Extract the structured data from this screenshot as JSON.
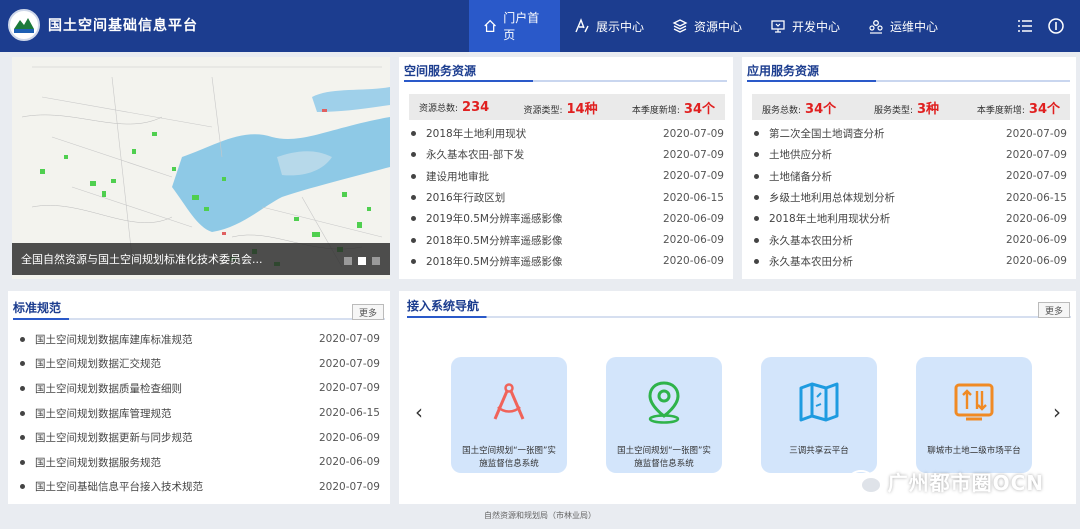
{
  "header": {
    "title": "国土空间基础信息平台",
    "nav": [
      {
        "label": "门户首页",
        "icon": "home-icon",
        "active": true
      },
      {
        "label": "展示中心",
        "icon": "display-icon",
        "active": false
      },
      {
        "label": "资源中心",
        "icon": "layers-icon",
        "active": false
      },
      {
        "label": "开发中心",
        "icon": "monitor-icon",
        "active": false
      },
      {
        "label": "运维中心",
        "icon": "users-icon",
        "active": false
      }
    ]
  },
  "slider": {
    "caption": "全国自然资源与国土空间规划标准化技术委员会...",
    "active_dot": 2
  },
  "spatial": {
    "title": "空间服务资源",
    "stats": [
      {
        "label": "资源总数:",
        "value": "234"
      },
      {
        "label": "资源类型:",
        "value": "14种"
      },
      {
        "label": "本季度新增:",
        "value": "34个"
      }
    ],
    "items": [
      {
        "title": "2018年土地利用现状",
        "date": "2020-07-09"
      },
      {
        "title": "永久基本农田-部下发",
        "date": "2020-07-09"
      },
      {
        "title": "建设用地审批",
        "date": "2020-07-09"
      },
      {
        "title": "2016年行政区划",
        "date": "2020-06-15"
      },
      {
        "title": "2019年0.5M分辨率遥感影像",
        "date": "2020-06-09"
      },
      {
        "title": "2018年0.5M分辨率遥感影像",
        "date": "2020-06-09"
      },
      {
        "title": "2018年0.5M分辨率遥感影像",
        "date": "2020-06-09"
      }
    ]
  },
  "app": {
    "title": "应用服务资源",
    "stats": [
      {
        "label": "服务总数:",
        "value": "34个"
      },
      {
        "label": "服务类型:",
        "value": "3种"
      },
      {
        "label": "本季度新增:",
        "value": "34个"
      }
    ],
    "items": [
      {
        "title": "第二次全国土地调查分析",
        "date": "2020-07-09"
      },
      {
        "title": "土地供应分析",
        "date": "2020-07-09"
      },
      {
        "title": "土地储备分析",
        "date": "2020-07-09"
      },
      {
        "title": "乡级土地利用总体规划分析",
        "date": "2020-06-15"
      },
      {
        "title": "2018年土地利用现状分析",
        "date": "2020-06-09"
      },
      {
        "title": "永久基本农田分析",
        "date": "2020-06-09"
      },
      {
        "title": "永久基本农田分析",
        "date": "2020-06-09"
      }
    ]
  },
  "standards": {
    "title": "标准规范",
    "more": "更多",
    "items": [
      {
        "title": "国土空间规划数据库建库标准规范",
        "date": "2020-07-09"
      },
      {
        "title": "国土空间规划数据汇交规范",
        "date": "2020-07-09"
      },
      {
        "title": "国土空间规划数据质量检查细则",
        "date": "2020-07-09"
      },
      {
        "title": "国土空间规划数据库管理规范",
        "date": "2020-06-15"
      },
      {
        "title": "国土空间规划数据更新与同步规范",
        "date": "2020-06-09"
      },
      {
        "title": "国土空间规划数据服务规范",
        "date": "2020-06-09"
      },
      {
        "title": "国土空间基础信息平台接入技术规范",
        "date": "2020-07-09"
      }
    ]
  },
  "systems": {
    "title": "接入系统导航",
    "more": "更多",
    "prev": "‹",
    "next": "›",
    "cards": [
      {
        "label": "国土空间规划“一张图”实施监督信息系统",
        "icon": "compass-icon",
        "color": "#f0635a"
      },
      {
        "label": "国土空间规划“一张图”实施监督信息系统",
        "icon": "map-pin-icon",
        "color": "#2fb34a"
      },
      {
        "label": "三调共享云平台",
        "icon": "folded-map-icon",
        "color": "#1e9be0"
      },
      {
        "label": "聊城市土地二级市场平台",
        "icon": "market-icon",
        "color": "#f08a24"
      }
    ]
  },
  "footer": {
    "text": "自然资源和规划局（市林业局）"
  },
  "watermark": {
    "text": "广州都市圈OCN"
  }
}
